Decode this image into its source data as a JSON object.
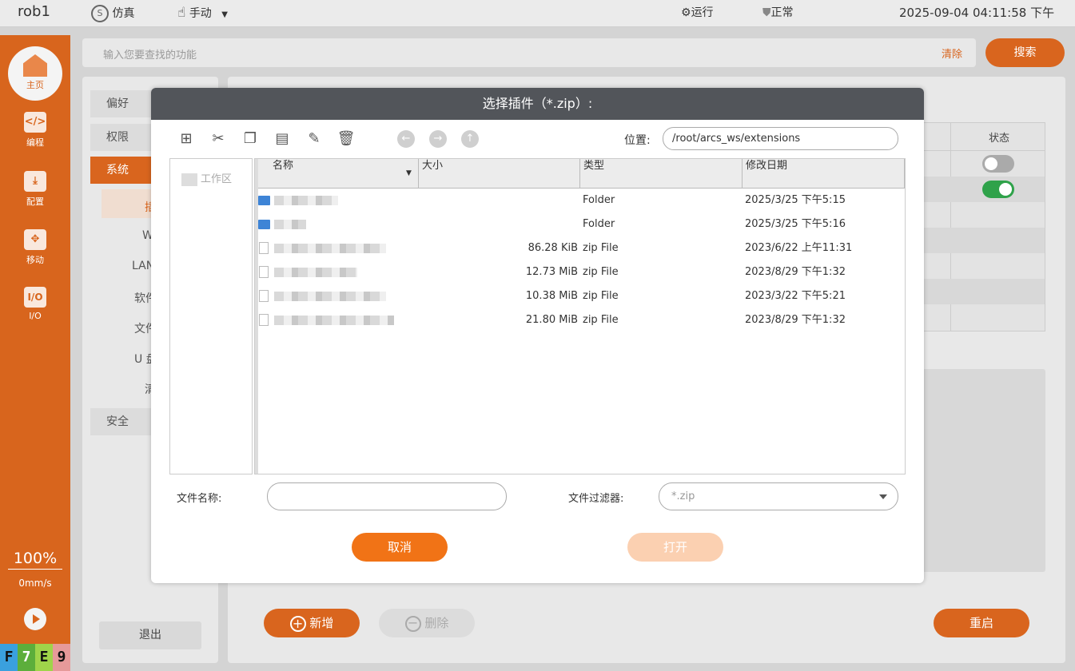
{
  "topbar": {
    "robot_name": "rob1",
    "sim_label": "仿真",
    "mode_label": "手动",
    "run_label": "运行",
    "status_label": "正常",
    "datetime": "2025-09-04 04:11:58 下午"
  },
  "rail": {
    "home_label": "主页",
    "items": [
      {
        "label": "编程",
        "icon": "code-icon"
      },
      {
        "label": "配置",
        "icon": "download-icon"
      },
      {
        "label": "移动",
        "icon": "move-icon"
      },
      {
        "label": "I/O",
        "icon": "io-icon"
      }
    ],
    "speed_pct": "100%",
    "speed_value": "0mm/s",
    "fkeys": [
      "F",
      "7",
      "E",
      "9"
    ]
  },
  "search": {
    "placeholder": "输入您要查找的功能",
    "clear_label": "清除",
    "search_label": "搜索"
  },
  "settings_menu": {
    "items": [
      "偏好",
      "权限",
      "系统",
      "安全"
    ],
    "sub_items": [
      "插",
      "W",
      "LAN",
      "软件",
      "文件",
      "U 盘",
      "清"
    ],
    "logout_label": "退出"
  },
  "main": {
    "status_header": "状态",
    "add_label": "新增",
    "delete_label": "删除",
    "restart_label": "重启"
  },
  "dialog": {
    "title": "选择插件（*.zip）:",
    "location_label": "位置:",
    "location_value": "/root/arcs_ws/extensions",
    "sidebar_item": "工作区",
    "columns": {
      "name": "名称",
      "size": "大小",
      "type": "类型",
      "date": "修改日期"
    },
    "rows": [
      {
        "kind": "folder",
        "size": "",
        "type": "Folder",
        "date": "2025/3/25 下午5:15"
      },
      {
        "kind": "folder",
        "size": "",
        "type": "Folder",
        "date": "2025/3/25 下午5:16"
      },
      {
        "kind": "file",
        "size": "86.28 KiB",
        "type": "zip File",
        "date": "2023/6/22 上午11:31"
      },
      {
        "kind": "file",
        "size": "12.73 MiB",
        "type": "zip File",
        "date": "2023/8/29 下午1:32"
      },
      {
        "kind": "file",
        "size": "10.38 MiB",
        "type": "zip File",
        "date": "2023/3/22 下午5:21"
      },
      {
        "kind": "file",
        "size": "21.80 MiB",
        "type": "zip File",
        "date": "2023/8/29 下午1:32"
      }
    ],
    "filename_label": "文件名称:",
    "filename_value": "",
    "filter_label": "文件过滤器:",
    "filter_value": "*.zip",
    "cancel_label": "取消",
    "open_label": "打开"
  },
  "colors": {
    "accent": "#d9651e",
    "dialog_title_bg": "#52555a"
  }
}
